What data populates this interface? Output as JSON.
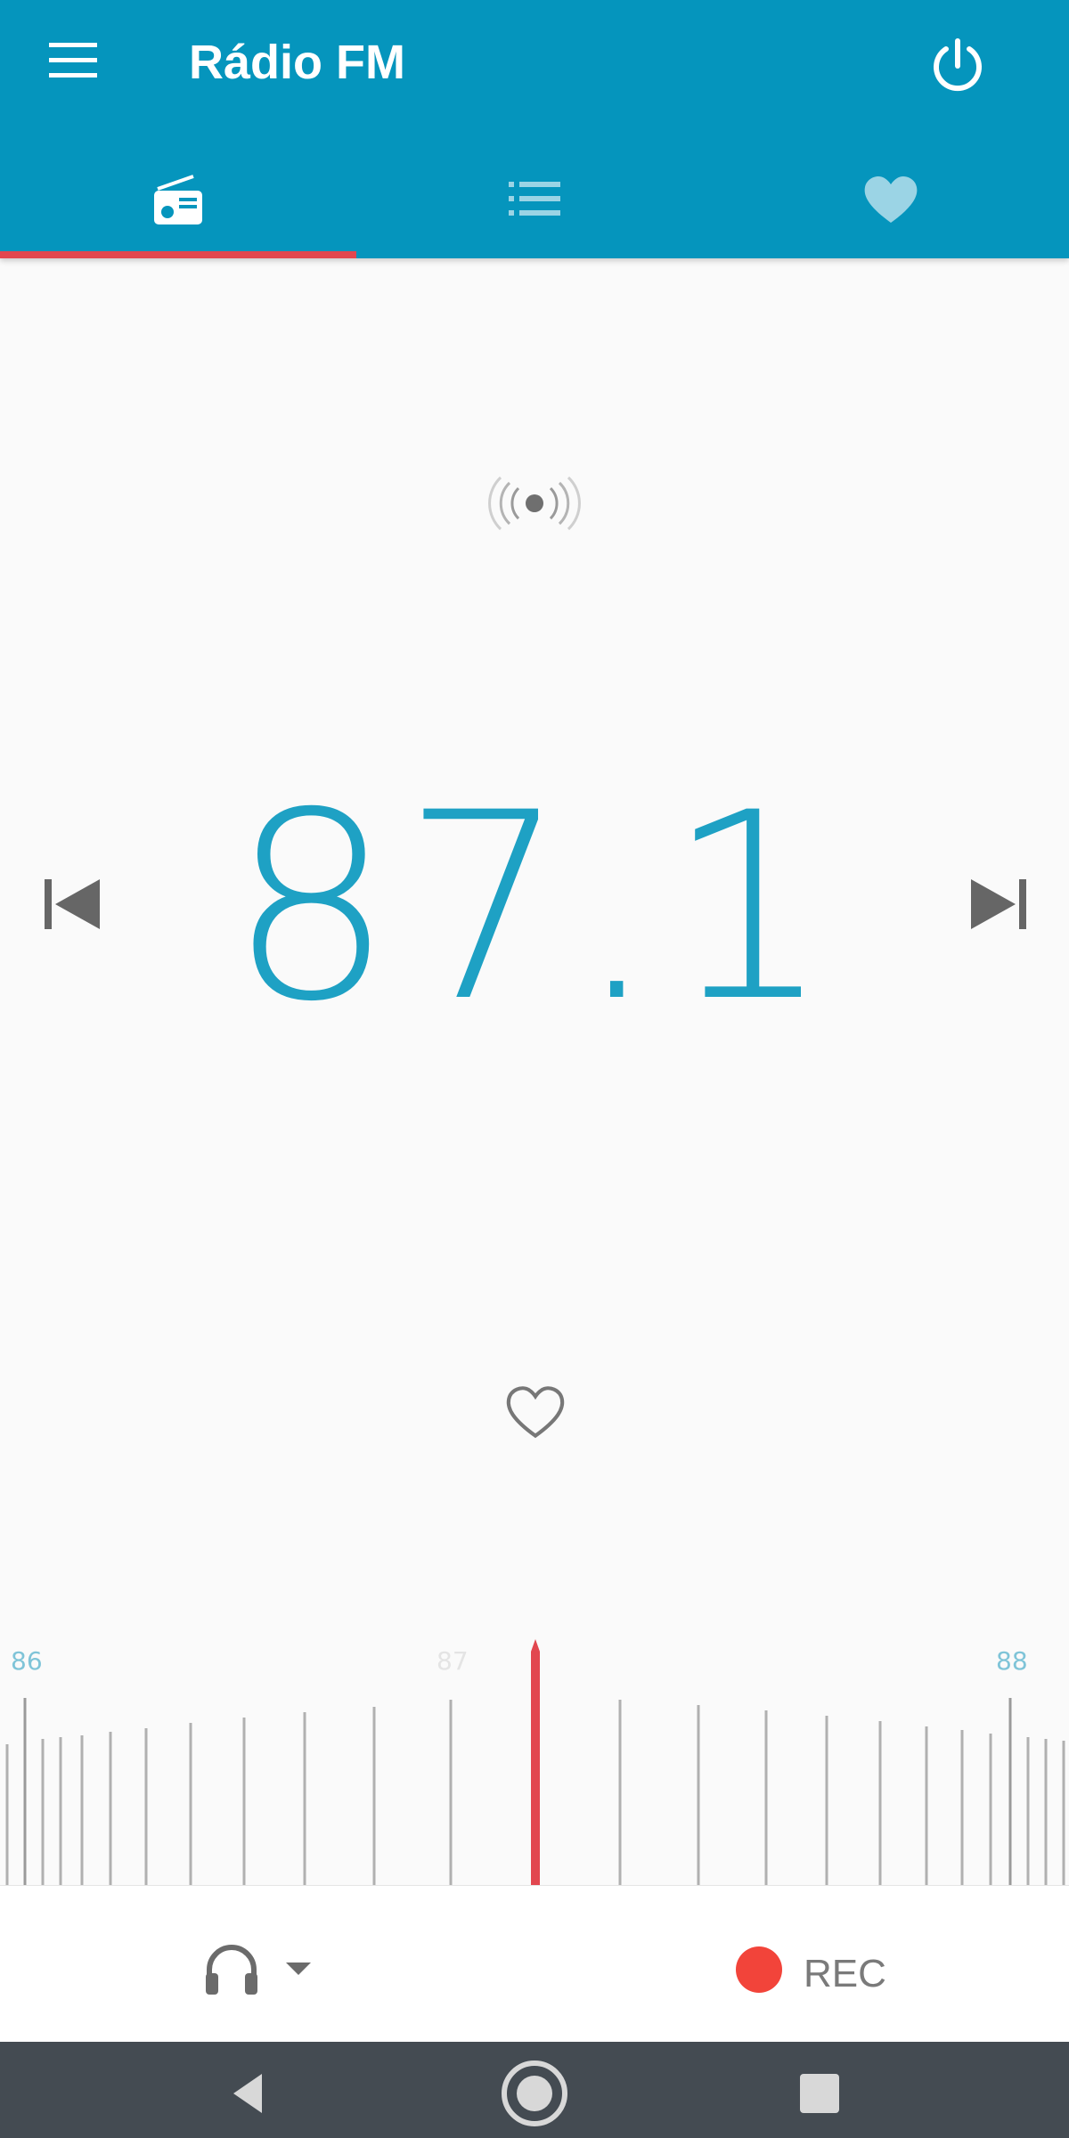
{
  "app": {
    "title": "Rádio FM"
  },
  "header": {
    "menu_icon": "hamburger-menu-icon",
    "power_icon": "power-icon",
    "tabs": [
      {
        "name": "radio",
        "icon": "radio-icon",
        "selected": true
      },
      {
        "name": "station-list",
        "icon": "list-icon",
        "selected": false
      },
      {
        "name": "favorites",
        "icon": "heart-icon",
        "selected": false
      }
    ]
  },
  "tuner": {
    "frequency": "87.1",
    "signal_icon": "broadcast-signal-icon",
    "prev_icon": "skip-previous-icon",
    "next_icon": "skip-next-icon",
    "favorite_icon": "heart-outline-icon"
  },
  "scale": {
    "labels": [
      "86",
      "87",
      "88"
    ]
  },
  "controls": {
    "audio_output_icon": "headphones-icon",
    "rec_label": "REC"
  },
  "navbar": {
    "icons": [
      "back-icon",
      "home-icon",
      "recents-icon"
    ]
  },
  "colors": {
    "primary": "#0595bd",
    "accent": "#e2474f",
    "frequency": "#1ea1c4",
    "record": "#f2443a"
  }
}
